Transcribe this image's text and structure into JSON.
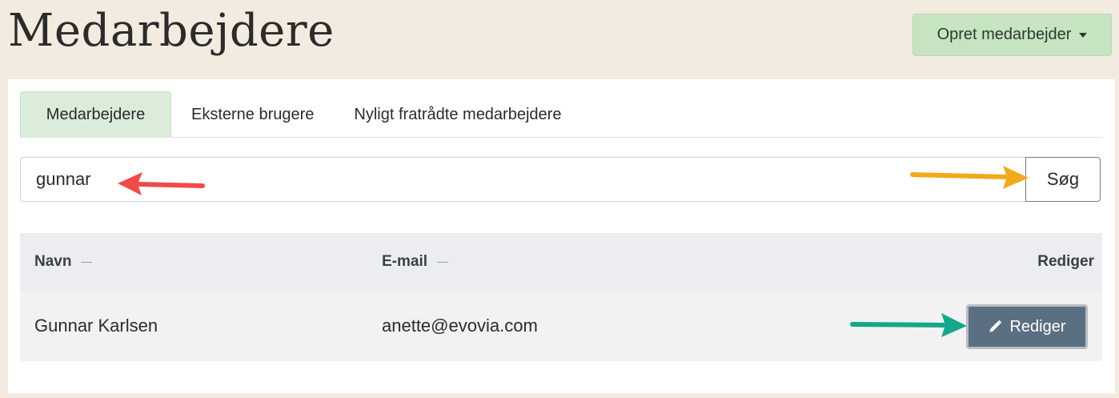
{
  "header": {
    "title": "Medarbejdere",
    "create_button": "Opret medarbejder"
  },
  "tabs": [
    {
      "label": "Medarbejdere",
      "active": true
    },
    {
      "label": "Eksterne brugere",
      "active": false
    },
    {
      "label": "Nyligt fratrådte medarbejdere",
      "active": false
    }
  ],
  "search": {
    "value": "gunnar",
    "button": "Søg"
  },
  "table": {
    "columns": [
      "Navn",
      "E-mail",
      "Rediger"
    ],
    "rows": [
      {
        "name": "Gunnar Karlsen",
        "email": "anette@evovia.com",
        "edit": "Rediger"
      }
    ]
  },
  "annotations": {
    "red_arrow_color": "#f04b4b",
    "yellow_arrow_color": "#f2a91b",
    "green_arrow_color": "#14a88a"
  },
  "colors": {
    "background": "#f3ebe0",
    "create_button": "#c6e3c2",
    "active_tab": "#dcecdb",
    "edit_button": "#5a6f82"
  }
}
